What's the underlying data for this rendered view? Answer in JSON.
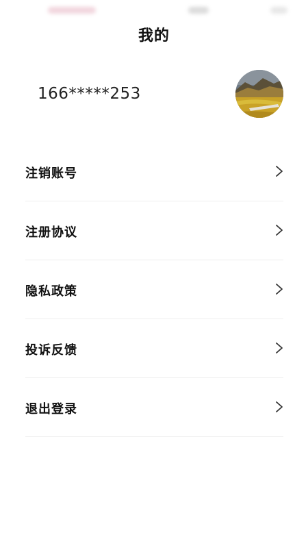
{
  "header": {
    "title": "我的"
  },
  "profile": {
    "phone": "166*****253",
    "avatar_icon": "landscape-avatar-icon"
  },
  "menu": {
    "items": [
      {
        "label": "注销账号",
        "icon": "chevron-right-icon"
      },
      {
        "label": "注册协议",
        "icon": "chevron-right-icon"
      },
      {
        "label": "隐私政策",
        "icon": "chevron-right-icon"
      },
      {
        "label": "投诉反馈",
        "icon": "chevron-right-icon"
      },
      {
        "label": "退出登录",
        "icon": "chevron-right-icon"
      }
    ]
  },
  "colors": {
    "background": "#ffffff",
    "text": "#111111",
    "divider": "#eeeeee",
    "chevron": "#333333"
  }
}
